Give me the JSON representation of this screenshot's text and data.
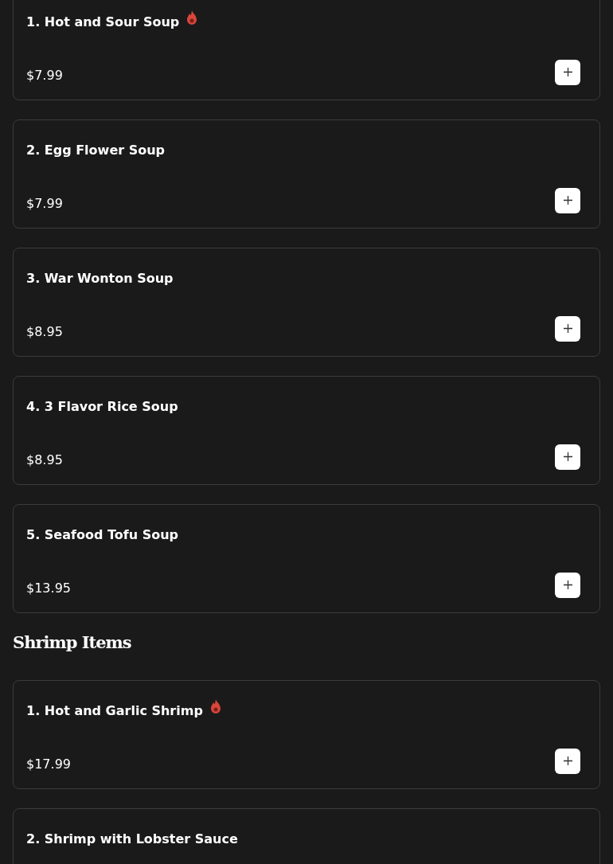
{
  "sections": [
    {
      "items": [
        {
          "name": "1. Hot and Sour Soup",
          "spicy": true,
          "price": "$7.99"
        },
        {
          "name": "2. Egg Flower Soup",
          "spicy": false,
          "price": "$7.99"
        },
        {
          "name": "3. War Wonton Soup",
          "spicy": false,
          "price": "$8.95"
        },
        {
          "name": "4. 3 Flavor Rice Soup",
          "spicy": false,
          "price": "$8.95"
        },
        {
          "name": "5. Seafood Tofu Soup",
          "spicy": false,
          "price": "$13.95"
        }
      ]
    },
    {
      "title": "Shrimp Items",
      "items": [
        {
          "name": "1. Hot and Garlic Shrimp",
          "spicy": true,
          "price": "$17.99"
        },
        {
          "name": "2. Shrimp with Lobster Sauce",
          "spicy": false
        }
      ]
    }
  ]
}
